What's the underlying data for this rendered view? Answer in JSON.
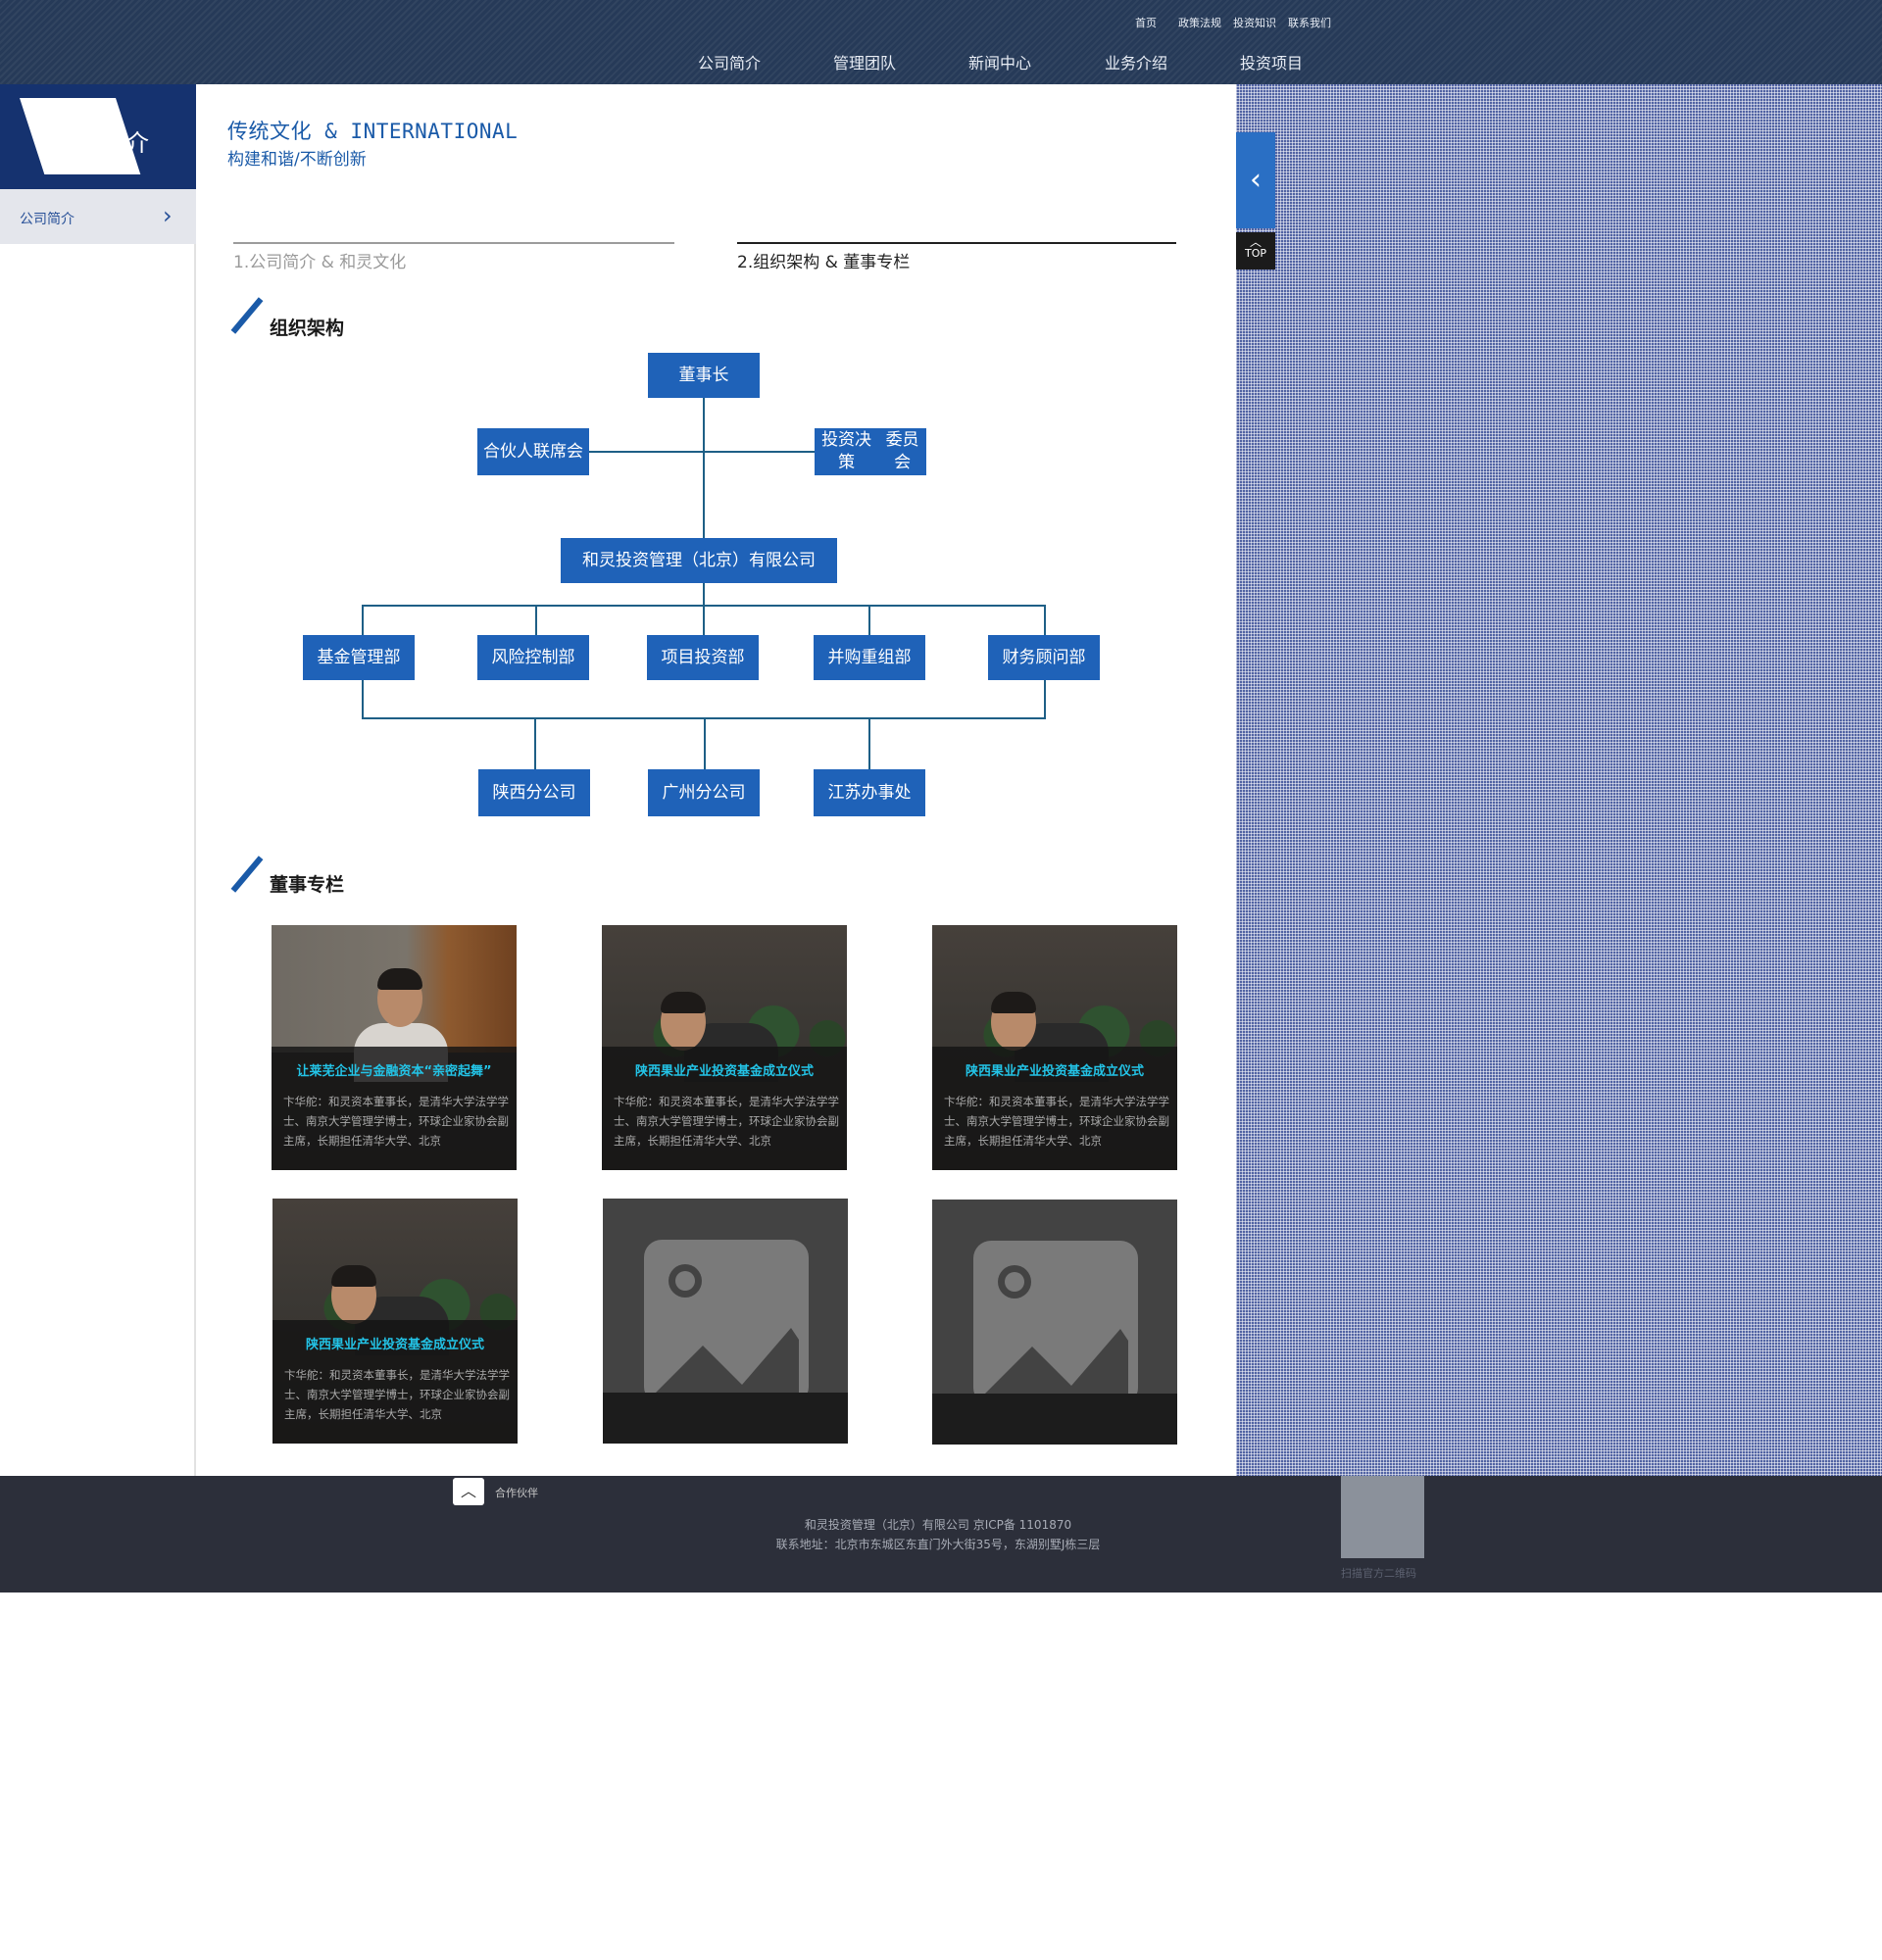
{
  "header": {
    "top_links": [
      "首页",
      "政策法规",
      "投资知识",
      "联系我们"
    ],
    "nav": [
      "公司简介",
      "管理团队",
      "新闻中心",
      "业务介绍",
      "投资项目"
    ]
  },
  "sidebar": {
    "title": "公司简介",
    "items": [
      {
        "label": "公司简介",
        "icon": "chevron-right-icon"
      }
    ]
  },
  "page": {
    "title": "传统文化 & INTERNATIONAL",
    "subtitle": "构建和谐/不断创新"
  },
  "tabs": [
    {
      "label": "1.公司简介 & 和灵文化",
      "active": false
    },
    {
      "label": "2.组织架构 & 董事专栏",
      "active": true
    }
  ],
  "org_section": {
    "title": "组织架构",
    "chart": {
      "chairman": "董事长",
      "partner": [
        "合伙人",
        "联席会"
      ],
      "committee": [
        "投资决策",
        "委员会"
      ],
      "company": "和灵投资管理（北京）有限公司",
      "departments": [
        "基金管理部",
        "风险控制部",
        "项目投资部",
        "并购重组部",
        "财务顾问部"
      ],
      "branches": [
        [
          "陕西",
          "分公司"
        ],
        [
          "广州",
          "分公司"
        ],
        [
          "江苏",
          "办事处"
        ]
      ]
    }
  },
  "directors_section": {
    "title": "董事专栏",
    "cards": [
      {
        "title": "让莱芜企业与金融资本“亲密起舞”",
        "desc": "卞华舵：和灵资本董事长，是清华大学法学学士、南京大学管理学博士，环球企业家协会副主席，长期担任清华大学、北京"
      },
      {
        "title": "陕西果业产业投资基金成立仪式",
        "desc": "卞华舵：和灵资本董事长，是清华大学法学学士、南京大学管理学博士，环球企业家协会副主席，长期担任清华大学、北京"
      },
      {
        "title": "陕西果业产业投资基金成立仪式",
        "desc": "卞华舵：和灵资本董事长，是清华大学法学学士、南京大学管理学博士，环球企业家协会副主席，长期担任清华大学、北京"
      },
      {
        "title": "陕西果业产业投资基金成立仪式",
        "desc": "卞华舵：和灵资本董事长，是清华大学法学学士、南京大学管理学博士，环球企业家协会副主席，长期担任清华大学、北京"
      }
    ],
    "placeholders": 2
  },
  "side_tools": {
    "back_icon": "chevron-left-icon",
    "top_label": "TOP"
  },
  "footer": {
    "partner_label": "合作伙伴",
    "company_line": "和灵投资管理（北京）有限公司 京ICP备 1101870",
    "address_line": "联系地址：北京市东城区东直门外大街35号，东湖别墅J栋三层",
    "qr_label": "扫描官方二维码"
  },
  "colors": {
    "header_bg": "#263a58",
    "accent_blue": "#1f62b8",
    "sidebar_head": "#15326f",
    "card_title": "#23c3e6",
    "footer_bg": "#2c2f3a"
  }
}
